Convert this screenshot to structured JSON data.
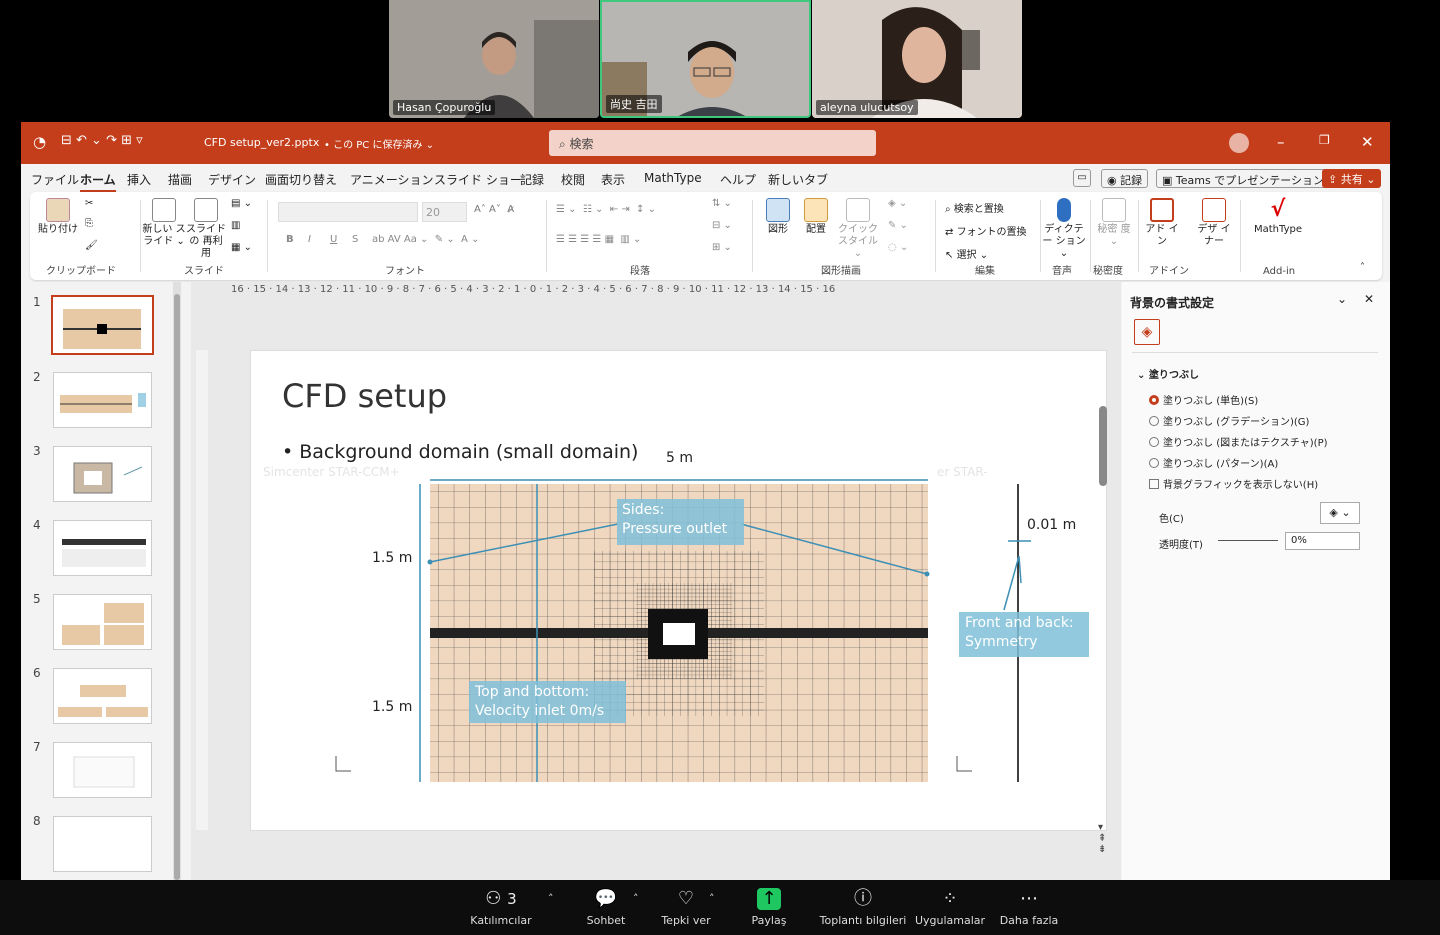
{
  "participants": [
    {
      "name": "Hasan Çopuroğlu"
    },
    {
      "name": "尚史 吉田"
    },
    {
      "name": "aleyna ulucutsoy"
    }
  ],
  "titlebar": {
    "file": "CFD setup_ver2.pptx",
    "saved": "• この PC に保存済み ⌄",
    "search": "検索",
    "qat": "⊟ ↶ ⌄ ↷ ⊞ ▿"
  },
  "menu": [
    "ファイル",
    "ホーム",
    "挿入",
    "描画",
    "デザイン",
    "画面切り替え",
    "アニメーション",
    "スライド ショー",
    "記録",
    "校閲",
    "表示",
    "MathType",
    "ヘルプ",
    "新しいタブ"
  ],
  "menu_right": {
    "record": "記録",
    "teams": "Teams でプレゼンテーション",
    "share": "共有 ⌄"
  },
  "ribbon": {
    "groups": [
      "クリップボード",
      "スライド",
      "フォント",
      "段落",
      "図形描画",
      "編集",
      "音声",
      "秘密度",
      "アドイン",
      "Add-in"
    ],
    "paste": "貼り付け",
    "new_slide": "新しい スライド ⌄",
    "reuse": "スライドの 再利用",
    "font_size": "20",
    "bold": "B",
    "italic": "I",
    "underline": "U",
    "strike": "S",
    "shape": "図形",
    "arrange": "配置",
    "quick": "クイック スタイル ⌄",
    "find": "検索と置換",
    "replace": "フォントの置換",
    "select": "選択 ⌄",
    "dictate": "ディクテー ション ⌄",
    "sensitivity": "秘密 度 ⌄",
    "addin": "アド イン",
    "designer": "デザ イナー",
    "mathtype": "MathType"
  },
  "ruler": "16 · 15 · 14 · 13 · 12 · 11 · 10 · 9 · 8 · 7 · 6 · 5 · 4 · 3 · 2 · 1 · 0 · 1 · 2 · 3 · 4 · 5 · 6 · 7 · 8 · 9 · 10 · 11 · 12 · 13 · 14 · 15 · 16",
  "thumbs": [
    "1",
    "2",
    "3",
    "4",
    "5",
    "6",
    "7",
    "8"
  ],
  "slide": {
    "title": "CFD setup",
    "bullet": "Background domain (small domain)",
    "width": "5 m",
    "h1": "1.5 m",
    "h2": "1.5 m",
    "thickness": "0.01 m",
    "sides": "Sides:",
    "sides2": "Pressure outlet",
    "topbottom": "Top and bottom:",
    "topbottom2": "Velocity inlet 0m/s",
    "frontback": "Front and back:",
    "frontback2": "Symmetry",
    "watermark": "Simcenter STAR-CCM+",
    "watermark2": "er STAR-"
  },
  "pane": {
    "title": "背景の書式設定",
    "section": "塗りつぶし",
    "options": [
      "塗りつぶし (単色)(S)",
      "塗りつぶし (グラデーション)(G)",
      "塗りつぶし (図またはテクスチャ)(P)",
      "塗りつぶし (パターン)(A)"
    ],
    "hide_bg": "背景グラフィックを表示しない(H)",
    "color": "色(C)",
    "transparency": "透明度(T)",
    "trans_value": "0%"
  },
  "bottombar": [
    {
      "label": "Katılımcılar",
      "count": "3"
    },
    {
      "label": "Sohbet"
    },
    {
      "label": "Tepki ver"
    },
    {
      "label": "Paylaş"
    },
    {
      "label": "Toplantı bilgileri"
    },
    {
      "label": "Uygulamalar"
    },
    {
      "label": "Daha fazla"
    }
  ],
  "colors": {
    "accent": "#c43e1c",
    "mesh": "#f0d8c0",
    "label": "#7fbfd8",
    "share": "#1ec760"
  }
}
